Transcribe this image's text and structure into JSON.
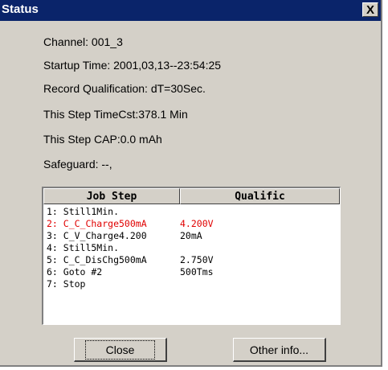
{
  "window": {
    "title": "Status",
    "close_glyph": "X"
  },
  "info": {
    "channel": "Channel:  001_3",
    "startup_time": "Startup Time:   2001,03,13--23:54:25",
    "record_qualification": "Record Qualification:   dT=30Sec.",
    "step_time": "This Step TimeCst:378.1 Min",
    "step_cap": "This Step CAP:0.0 mAh",
    "safeguard": "Safeguard:   --,"
  },
  "job_table": {
    "headers": [
      "Job Step",
      "Qualific"
    ],
    "selected_row": 1,
    "rows": [
      {
        "step": "1: Still1Min.",
        "qualific": ""
      },
      {
        "step": "2: C_C_Charge500mA",
        "qualific": "4.200V"
      },
      {
        "step": "3: C_V_Charge4.200",
        "qualific": "20mA"
      },
      {
        "step": "4: Still5Min.",
        "qualific": ""
      },
      {
        "step": "5: C_C_DisChg500mA",
        "qualific": "2.750V"
      },
      {
        "step": "6: Goto #2",
        "qualific": "500Tms"
      },
      {
        "step": "7: Stop",
        "qualific": ""
      }
    ]
  },
  "buttons": {
    "close": "Close",
    "other_info": "Other info..."
  },
  "colors": {
    "title_bar": "#0a246a",
    "dialog_face": "#d4d0c8",
    "selected_row_text": "#e00000"
  }
}
